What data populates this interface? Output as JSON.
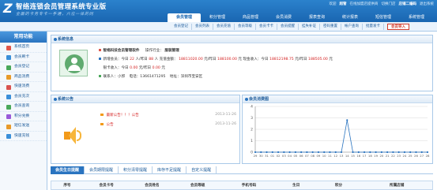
{
  "header": {
    "logo": "Z",
    "title": "智络连锁会员管理系统专业版",
    "slogan": "全面的卡务专卡一手通，六位一体的同",
    "links": {
      "welcome": "欢迎",
      "user": "超管",
      "store": "在线加盟店提供商",
      "switch_store": "切换门店",
      "login_info": "店铺二编码",
      "logout": "退出系统"
    },
    "tabs": [
      "会员管理",
      "积分管理",
      "商品管理",
      "会员消费",
      "报表查询",
      "统计报表",
      "短信管理",
      "系统管理"
    ]
  },
  "subnav": [
    "会员登记",
    "会员列表",
    "会员充值",
    "会员等级",
    "会员卡卡",
    "会员提醒",
    "挂失补证",
    "密码重置",
    "帐户查询",
    "批量发卡",
    "会员导入"
  ],
  "sidebar": {
    "title": "常用功能",
    "items": [
      {
        "label": "系统首页",
        "color": "#e0554a"
      },
      {
        "label": "会员刷卡",
        "color": "#3a8fd9"
      },
      {
        "label": "会员登记",
        "color": "#4aa85a"
      },
      {
        "label": "商品消费",
        "color": "#e89a2a"
      },
      {
        "label": "快速消费",
        "color": "#d9534f"
      },
      {
        "label": "会员充次",
        "color": "#3a8fd9"
      },
      {
        "label": "会员查询",
        "color": "#4aa85a"
      },
      {
        "label": "积分兑换",
        "color": "#9a5ad9"
      },
      {
        "label": "短信发送",
        "color": "#e89a2a"
      },
      {
        "label": "快速充钱",
        "color": "#3a8fd9"
      }
    ]
  },
  "sysinfo": {
    "title": "系统信息",
    "line1": {
      "brand": "智络科技会员管理软件",
      "industry_label": "操作行业：",
      "industry": "服装管理"
    },
    "line2": {
      "new_label": "新增会员：今日",
      "new_today": "22",
      "new_unit": "人/昨日",
      "new_yday": "88",
      "new_tail": "人 充值金额：",
      "recharge_today": "18811020.00",
      "recharge_mid": "元/昨日",
      "recharge_yday": "188100.00",
      "cash_label": "元 现金收入：今日",
      "cash_today": "18812198.75",
      "cash_mid": "元/昨日",
      "cash_yday": "188505.00",
      "cash_unit": "元"
    },
    "line3": {
      "label": "银卡收入：今日",
      "today": "0.00",
      "mid": "元/昨日",
      "yday": "0.00",
      "unit": "元"
    },
    "line4": {
      "contact": "联系人：小郭",
      "phone": "电话：13661471295",
      "address": "地址：深圳市宝安区"
    }
  },
  "notice": {
    "title": "系统公告",
    "items": [
      {
        "title": "最新公告！！！公告",
        "date": "2013-11-26"
      },
      {
        "title": "公告",
        "date": "2013-11-26"
      }
    ]
  },
  "chart": {
    "title": "会员消费图"
  },
  "chart_data": {
    "type": "line",
    "title": "",
    "xlabel": "",
    "ylabel": "",
    "x": [
      "29",
      "30",
      "31",
      "01",
      "02",
      "03",
      "04",
      "05",
      "06",
      "07",
      "08",
      "09",
      "10",
      "11",
      "12",
      "13",
      "14",
      "15",
      "16",
      "17",
      "18",
      "19",
      "20",
      "21",
      "22",
      "23",
      "24",
      "25",
      "26",
      "27",
      "28"
    ],
    "series": [
      {
        "values": [
          0,
          0,
          0,
          0,
          0,
          0,
          0,
          0,
          0,
          0,
          0,
          0,
          0,
          0,
          0,
          0,
          2.8,
          0,
          0,
          0,
          0,
          0,
          0,
          0,
          0,
          0,
          0,
          0,
          0,
          0,
          0
        ]
      }
    ],
    "yticks": [
      0,
      1,
      2,
      3,
      4
    ],
    "ylim": [
      0,
      4
    ],
    "grid": true,
    "color": "#2a74c0"
  },
  "bottom_tabs": [
    "会员生日提醒",
    "会员期限提醒",
    "积分清零提醒",
    "库存不足提醒",
    "自定义提醒"
  ],
  "table": {
    "headers": [
      "序号",
      "会员卡号",
      "会员姓名",
      "会员等级",
      "手机号码",
      "生日",
      "积分",
      "所属店铺"
    ]
  }
}
